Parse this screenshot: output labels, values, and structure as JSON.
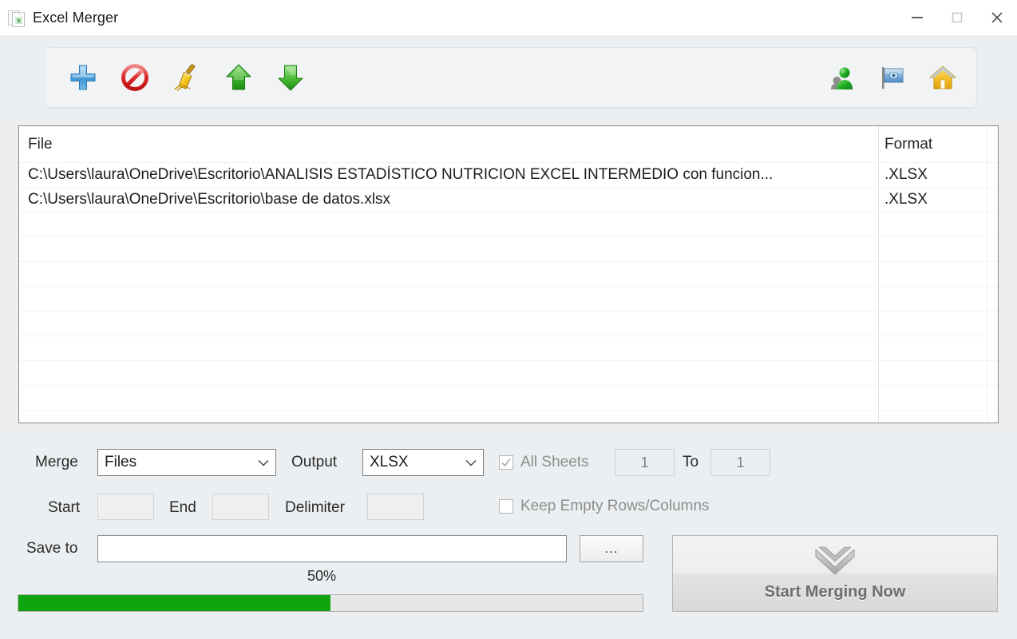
{
  "window": {
    "title": "Excel Merger",
    "app_icon": "excel-document-icon",
    "minimize_label": "Minimize",
    "maximize_label": "Maximize",
    "close_label": "Close"
  },
  "toolbar": {
    "left_buttons": [
      {
        "name": "add-files-button",
        "icon": "blue-plus-icon",
        "tooltip": "Add"
      },
      {
        "name": "remove-files-button",
        "icon": "red-prohibition-icon",
        "tooltip": "Remove"
      },
      {
        "name": "clear-list-button",
        "icon": "yellow-broom-icon",
        "tooltip": "Clear"
      },
      {
        "name": "move-up-button",
        "icon": "green-up-arrow-icon",
        "tooltip": "Move Up"
      },
      {
        "name": "move-down-button",
        "icon": "green-down-arrow-icon",
        "tooltip": "Move Down"
      }
    ],
    "right_buttons": [
      {
        "name": "user-button",
        "icon": "green-person-icon",
        "tooltip": "Account"
      },
      {
        "name": "flag-button",
        "icon": "blue-flag-icon",
        "tooltip": "Language"
      },
      {
        "name": "home-button",
        "icon": "yellow-home-icon",
        "tooltip": "Home"
      }
    ]
  },
  "file_list": {
    "columns": [
      "File",
      "Format"
    ],
    "rows": [
      {
        "file": "C:\\Users\\laura\\OneDrive\\Escritorio\\ANALISIS ESTADÍSTICO NUTRICION EXCEL INTERMEDIO con funcion...",
        "format": ".XLSX"
      },
      {
        "file": "C:\\Users\\laura\\OneDrive\\Escritorio\\base de datos.xlsx",
        "format": ".XLSX"
      }
    ],
    "empty_row_count": 9
  },
  "options": {
    "merge_label": "Merge",
    "merge_value": "Files",
    "output_label": "Output",
    "output_value": "XLSX",
    "all_sheets_label": "All Sheets",
    "all_sheets_checked": true,
    "sheet_from": "1",
    "to_label": "To",
    "sheet_to": "1",
    "start_label": "Start",
    "start_value": "",
    "end_label": "End",
    "end_value": "",
    "delimiter_label": "Delimiter",
    "delimiter_value": "",
    "keep_empty_label": "Keep Empty Rows/Columns",
    "keep_empty_checked": false,
    "save_to_label": "Save to",
    "save_to_value": "",
    "browse_label": "...",
    "progress_percent_label": "50%",
    "progress_percent": 50,
    "start_merging_label": "Start Merging Now",
    "start_merging_icon": "double-chevron-down-icon"
  },
  "colors": {
    "progress_fill": "#10a410",
    "window_background": "#eceff1",
    "accent_blue": "#4f9fd4",
    "accent_green": "#2bab2b",
    "accent_red": "#e03030",
    "accent_yellow": "#f3c11d"
  }
}
